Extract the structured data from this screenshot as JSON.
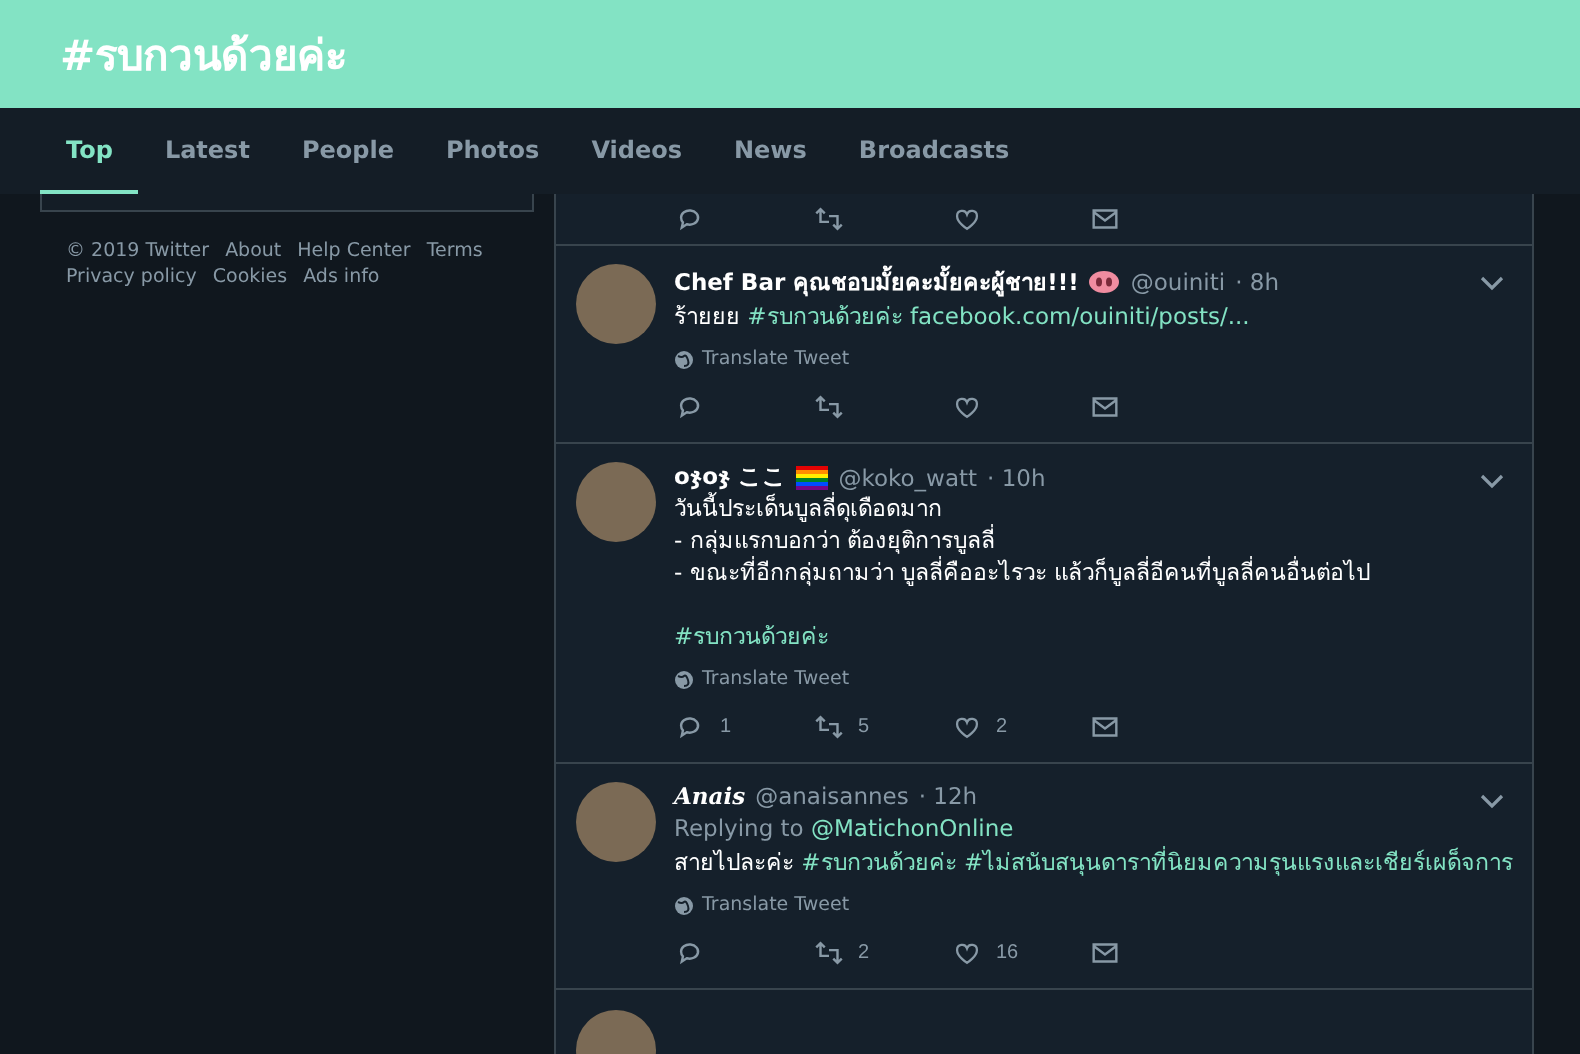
{
  "header": {
    "title": "#รบกวนด้วยค่ะ"
  },
  "tabs": [
    {
      "label": "Top",
      "selected": true
    },
    {
      "label": "Latest",
      "selected": false
    },
    {
      "label": "People",
      "selected": false
    },
    {
      "label": "Photos",
      "selected": false
    },
    {
      "label": "Videos",
      "selected": false
    },
    {
      "label": "News",
      "selected": false
    },
    {
      "label": "Broadcasts",
      "selected": false
    }
  ],
  "footer_links": [
    "© 2019 Twitter",
    "About",
    "Help Center",
    "Terms",
    "Privacy policy",
    "Cookies",
    "Ads info"
  ],
  "tweets": [
    {
      "name": "Chef Bar คุณชอบมั้ยคะมั้ยคะผู้ชาย!!!",
      "name_italic": false,
      "badge": {
        "kind": "pig"
      },
      "handle": "@ouiniti",
      "time": "· 8h",
      "paragraphs": [
        {
          "gap_before": false,
          "spans": [
            {
              "kind": "text",
              "text": "ร้ายยย"
            },
            {
              "kind": "hashtag",
              "text": "#รบกวนด้วยค่ะ"
            },
            {
              "kind": "link",
              "text": "facebook.com/ouiniti/posts/..."
            }
          ]
        }
      ],
      "translate": "Translate Tweet"
    },
    {
      "name": "oჯoჯ ここ",
      "name_italic": false,
      "badge": {
        "kind": "rainbow"
      },
      "handle": "@koko_watt",
      "time": "· 10h",
      "paragraphs": [
        {
          "gap_before": false,
          "spans": [
            {
              "kind": "text",
              "text": "วันนี้ประเด็นบูลลี่ดุเดือดมาก"
            }
          ]
        },
        {
          "gap_before": false,
          "spans": [
            {
              "kind": "text",
              "text": "- กลุ่มแรกบอกว่า ต้องยุติการบูลลี่"
            }
          ]
        },
        {
          "gap_before": false,
          "spans": [
            {
              "kind": "text",
              "text": "- ขณะที่อีกกลุ่มถามว่า บูลลี่คืออะไรวะ แล้วก็บูลลี่อีคนที่บูลลี่คนอื่นต่อไป"
            }
          ]
        },
        {
          "gap_before": true,
          "spans": [
            {
              "kind": "hashtag",
              "text": "#รบกวนด้วยค่ะ"
            }
          ]
        }
      ],
      "translate": "Translate Tweet",
      "replies": "1",
      "retweets": "5",
      "likes": "2"
    },
    {
      "name": "Anais",
      "name_italic": true,
      "handle": "@anaisannes",
      "time": "· 12h",
      "replying_label": "Replying to",
      "replying_to": "@MatichonOnline",
      "paragraphs": [
        {
          "gap_before": false,
          "spans": [
            {
              "kind": "text",
              "text": "สายไปละค่ะ"
            },
            {
              "kind": "hashtag",
              "text": "#รบกวนด้วยค่ะ"
            },
            {
              "kind": "hashtag",
              "text": "#ไม่สนับสนุนดาราที่นิยมความรุนแรงและเชียร์เผด็จการ"
            }
          ]
        }
      ],
      "translate": "Translate Tweet",
      "retweets": "2",
      "likes": "16"
    }
  ]
}
